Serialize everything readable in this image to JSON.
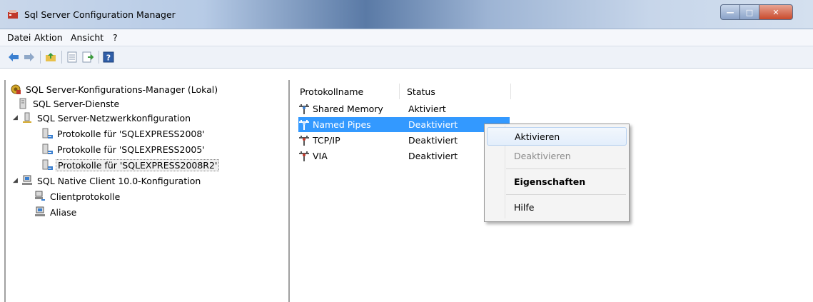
{
  "window": {
    "title": "Sql Server Configuration Manager"
  },
  "menu": [
    "Datei",
    "Aktion",
    "Ansicht",
    "?"
  ],
  "toolbar": {
    "icons": [
      "back-arrow-icon",
      "forward-arrow-icon",
      "up-folder-icon",
      "properties-icon",
      "export-icon",
      "help-icon"
    ]
  },
  "tree": [
    {
      "label": "SQL Server-Konfigurations-Manager (Lokal)",
      "icon": "config-manager-icon"
    },
    {
      "label": "SQL Server-Dienste",
      "icon": "services-icon"
    },
    {
      "label": "SQL Server-Netzwerkkonfiguration",
      "icon": "network-config-icon",
      "expanded": true
    },
    {
      "label": "Protokolle für 'SQLEXPRESS2008'",
      "icon": "protocol-icon"
    },
    {
      "label": "Protokolle für 'SQLEXPRESS2005'",
      "icon": "protocol-icon"
    },
    {
      "label": "Protokolle für 'SQLEXPRESS2008R2'",
      "icon": "protocol-icon",
      "selected": true
    },
    {
      "label": "SQL Native Client 10.0-Konfiguration",
      "icon": "native-client-icon",
      "expanded": true
    },
    {
      "label": "Clientprotokolle",
      "icon": "client-protocol-icon"
    },
    {
      "label": "Aliase",
      "icon": "alias-icon"
    }
  ],
  "list": {
    "columns": [
      "Protokollname",
      "Status"
    ],
    "rows": [
      {
        "name": "Shared Memory",
        "status": "Aktiviert"
      },
      {
        "name": "Named Pipes",
        "status": "Deaktiviert",
        "selected": true
      },
      {
        "name": "TCP/IP",
        "status": "Deaktiviert"
      },
      {
        "name": "VIA",
        "status": "Deaktiviert"
      }
    ]
  },
  "context_menu": {
    "items": [
      {
        "label": "Aktivieren",
        "state": "hover"
      },
      {
        "label": "Deaktivieren",
        "state": "disabled"
      },
      {
        "label": "Eigenschaften",
        "state": "default-bold"
      },
      {
        "label": "Hilfe",
        "state": "normal"
      }
    ]
  },
  "colors": {
    "selection": "#3399ff",
    "title_gradient_mid": "#5a7aa6"
  }
}
